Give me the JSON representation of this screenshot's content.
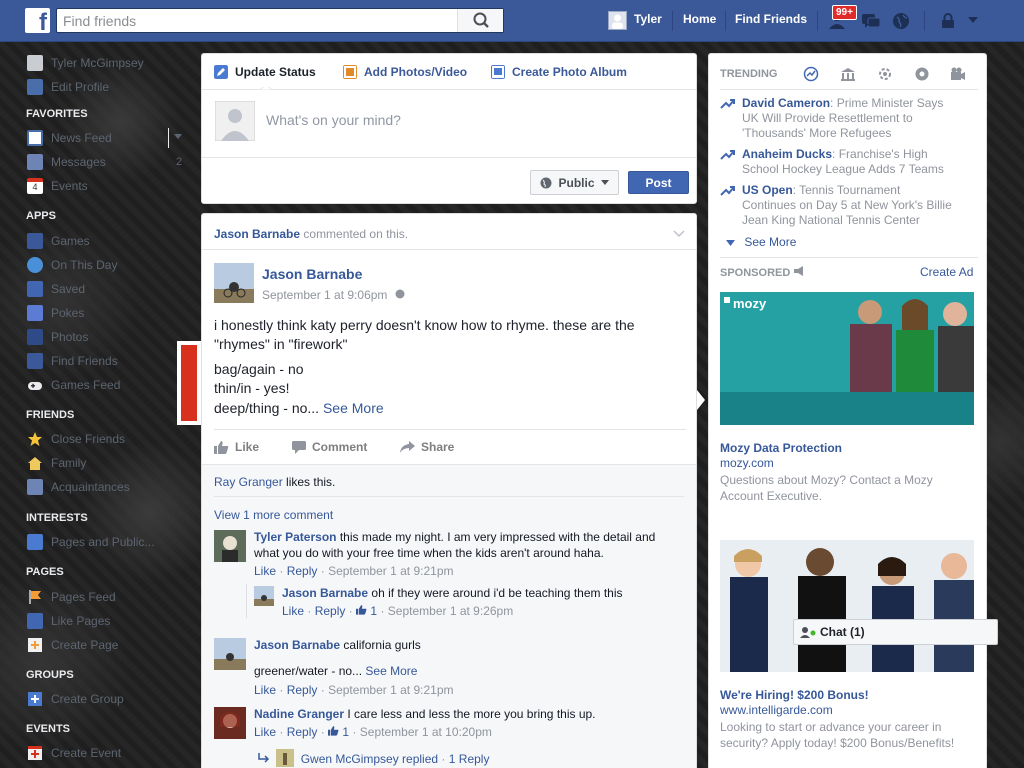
{
  "topbar": {
    "logo_letter": "f",
    "search_placeholder": "Find friends",
    "user_name": "Tyler",
    "nav_home": "Home",
    "nav_find_friends": "Find Friends",
    "notification_badge": "99+",
    "brand_color": "#3b5998"
  },
  "sidebar": {
    "profile_name": "Tyler McGimpsey",
    "edit_profile": "Edit Profile",
    "favorites_heading": "FAVORITES",
    "favorites": [
      {
        "label": "News Feed",
        "icon": "news-feed-icon"
      },
      {
        "label": "Messages",
        "icon": "messages-icon",
        "count": "2"
      },
      {
        "label": "Events",
        "icon": "calendar-icon",
        "icon_text": "4"
      }
    ],
    "apps_heading": "APPS",
    "apps": [
      {
        "label": "Games",
        "icon": "games-icon"
      },
      {
        "label": "On This Day",
        "icon": "on-this-day-icon"
      },
      {
        "label": "Saved",
        "icon": "saved-icon"
      },
      {
        "label": "Pokes",
        "icon": "pokes-icon"
      },
      {
        "label": "Photos",
        "icon": "photos-icon"
      },
      {
        "label": "Find Friends",
        "icon": "find-friends-icon"
      },
      {
        "label": "Games Feed",
        "icon": "gamepad-icon"
      }
    ],
    "friends_heading": "FRIENDS",
    "friends": [
      {
        "label": "Close Friends",
        "icon": "star-icon"
      },
      {
        "label": "Family",
        "icon": "house-icon"
      },
      {
        "label": "Acquaintances",
        "icon": "acquaintances-icon"
      }
    ],
    "interests_heading": "INTERESTS",
    "interests": [
      {
        "label": "Pages and Public...",
        "icon": "rss-icon"
      }
    ],
    "pages_heading": "PAGES",
    "pages": [
      {
        "label": "Pages Feed",
        "icon": "flag-icon"
      },
      {
        "label": "Like Pages",
        "icon": "like-pages-icon"
      },
      {
        "label": "Create Page",
        "icon": "create-page-icon"
      }
    ],
    "groups_heading": "GROUPS",
    "groups": [
      {
        "label": "Create Group",
        "icon": "plus-icon"
      }
    ],
    "events_heading": "EVENTS",
    "events": [
      {
        "label": "Create Event",
        "icon": "plus-icon"
      }
    ]
  },
  "composer": {
    "tab_update_status": "Update Status",
    "tab_add_photos": "Add Photos/Video",
    "tab_create_album": "Create Photo Album",
    "placeholder": "What's on your mind?",
    "privacy_label": "Public",
    "post_label": "Post"
  },
  "story": {
    "header_name": "Jason Barnabe",
    "header_suffix": "commented on this.",
    "author": "Jason Barnabe",
    "date": "September 1 at 9:06pm",
    "text_line1": "i honestly think katy perry doesn't know how to rhyme. these are the",
    "text_line2": "\"rhymes\" in \"firework\"",
    "text_line3": "bag/again - no",
    "text_line4": "thin/in - yes!",
    "text_line5": "deep/thing - no...",
    "see_more": "See More",
    "like_label": "Like",
    "comment_label": "Comment",
    "share_label": "Share",
    "likes_name": "Ray Granger",
    "likes_suffix": "likes this.",
    "view_more": "View 1 more comment",
    "comments": [
      {
        "author": "Tyler Paterson",
        "text_a": "this made my night. I am very impressed with the detail and",
        "text_b": "what you do with your free time when the kids aren't around haha.",
        "like": "Like",
        "reply": "Reply",
        "time": "September 1 at 9:21pm"
      },
      {
        "author": "Jason Barnabe",
        "text_a": "oh if they were around i'd be teaching them this",
        "like": "Like",
        "reply": "Reply",
        "likes_count": "1",
        "time": "September 1 at 9:26pm"
      },
      {
        "author": "Jason Barnabe",
        "text_a": "california gurls",
        "text_b": "greener/water - no...",
        "see_more": "See More",
        "like": "Like",
        "reply": "Reply",
        "time": "September 1 at 9:21pm"
      },
      {
        "author": "Nadine Granger",
        "text_a": "I care less and less the more you bring this up.",
        "like": "Like",
        "reply": "Reply",
        "likes_count": "1",
        "time": "September 1 at 10:20pm"
      }
    ],
    "reply_summary": "Gwen McGimpsey replied",
    "reply_count": "1 Reply"
  },
  "trending": {
    "heading": "TRENDING",
    "items": [
      {
        "topic": "David Cameron",
        "desc_a": ": Prime Minister Says",
        "desc_b": "UK Will Provide Resettlement to",
        "desc_c": "'Thousands' More Refugees"
      },
      {
        "topic": "Anaheim Ducks",
        "desc_a": ": Franchise's High",
        "desc_b": "School Hockey League Adds 7 Teams"
      },
      {
        "topic": "US Open",
        "desc_a": ": Tennis Tournament",
        "desc_b": "Continues on Day 5 at New York's Billie",
        "desc_c": "Jean King National Tennis Center"
      }
    ],
    "see_more": "See More"
  },
  "sponsored": {
    "heading": "SPONSORED",
    "create_ad": "Create Ad",
    "ads": [
      {
        "logo": "mozy",
        "title": "Mozy Data Protection",
        "url": "mozy.com",
        "desc": "Questions about Mozy? Contact a Mozy Account Executive."
      },
      {
        "title": "We're Hiring! $200 Bonus!",
        "url": "www.intelligarde.com",
        "desc": "Looking to start or advance your career in security? Apply today! $200 Bonus/Benefits!"
      }
    ]
  },
  "chat": {
    "label": "Chat (1)"
  }
}
